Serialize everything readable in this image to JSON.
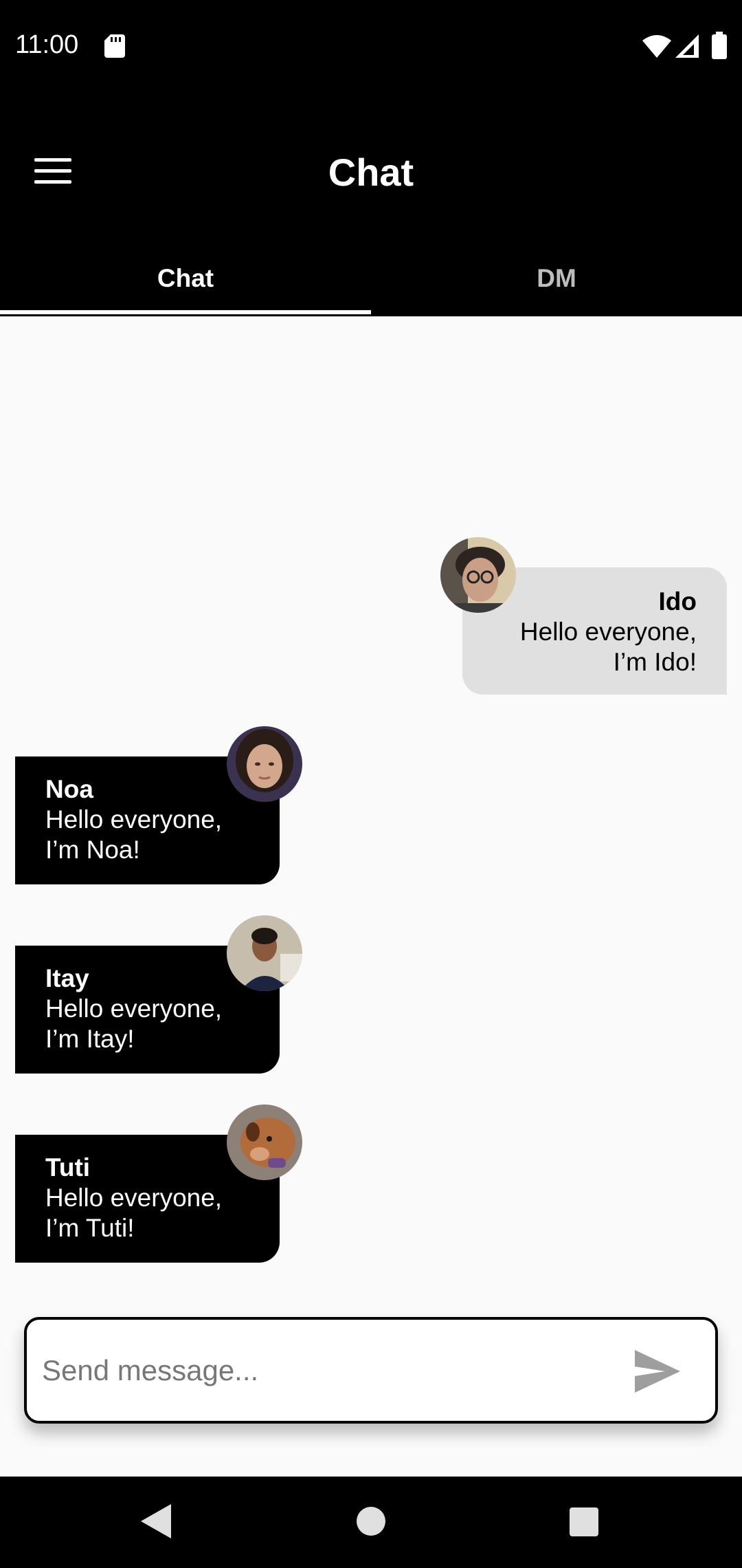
{
  "status_bar": {
    "time": "11:00"
  },
  "app_bar": {
    "title": "Chat"
  },
  "tabs": [
    {
      "label": "Chat",
      "active": true
    },
    {
      "label": "DM",
      "active": false
    }
  ],
  "messages": [
    {
      "sender": "Ido",
      "line1": "Hello everyone,",
      "line2": "I’m Ido!",
      "mine": true
    },
    {
      "sender": "Noa",
      "line1": "Hello everyone,",
      "line2": "I’m Noa!",
      "mine": false
    },
    {
      "sender": "Itay",
      "line1": "Hello everyone,",
      "line2": "I’m Itay!",
      "mine": false
    },
    {
      "sender": "Tuti",
      "line1": "Hello everyone,",
      "line2": "I’m Tuti!",
      "mine": false
    }
  ],
  "composer": {
    "placeholder": "Send message...",
    "value": ""
  },
  "colors": {
    "bar": "#000000",
    "background": "#fafafa",
    "my_bubble": "#e0e0e0",
    "their_bubble": "#000000"
  },
  "icons": [
    "sd-card-icon",
    "wifi-icon",
    "signal-icon",
    "battery-icon",
    "menu-icon",
    "send-icon",
    "back-icon",
    "home-icon",
    "recents-icon"
  ]
}
